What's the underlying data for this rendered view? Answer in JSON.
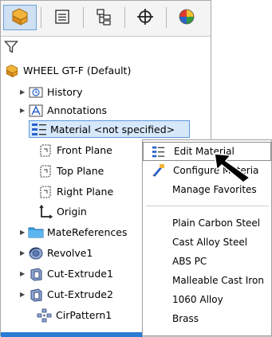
{
  "toolbar": {
    "icons": [
      "featuremanager-icon",
      "propertymanager-icon",
      "configurationmanager-icon",
      "dimxpert-icon",
      "display-manager-icon"
    ],
    "active_index": 0
  },
  "filter": {
    "icon": "filter-icon"
  },
  "tree": {
    "root": {
      "label": "WHEEL GT-F  (Default)",
      "icon": "part-icon"
    },
    "items": [
      {
        "label": "History",
        "icon": "history-icon",
        "expandable": true
      },
      {
        "label": "Annotations",
        "icon": "annotations-icon",
        "expandable": true
      },
      {
        "label": "Material <not specified>",
        "icon": "material-icon",
        "expandable": false,
        "selected": true
      },
      {
        "label": "Front Plane",
        "icon": "plane-icon",
        "expandable": false
      },
      {
        "label": "Top Plane",
        "icon": "plane-icon",
        "expandable": false
      },
      {
        "label": "Right Plane",
        "icon": "plane-icon",
        "expandable": false
      },
      {
        "label": "Origin",
        "icon": "origin-icon",
        "expandable": false
      },
      {
        "label": "MateReferences",
        "icon": "folder-icon",
        "expandable": true
      },
      {
        "label": "Revolve1",
        "icon": "revolve-icon",
        "expandable": true
      },
      {
        "label": "Cut-Extrude1",
        "icon": "cut-extrude-icon",
        "expandable": true
      },
      {
        "label": "Cut-Extrude2",
        "icon": "cut-extrude-icon",
        "expandable": true
      },
      {
        "label": "CirPattern1",
        "icon": "circular-pattern-icon",
        "expandable": false
      }
    ]
  },
  "context_menu": {
    "items": [
      {
        "label": "Edit Material",
        "icon": "edit-material-icon",
        "highlighted": true
      },
      {
        "label": "Configure Materia",
        "icon": "configure-material-icon"
      },
      {
        "label": "Manage Favorites"
      }
    ],
    "materials": [
      "Plain Carbon Steel",
      "Cast Alloy Steel",
      "ABS PC",
      "Malleable Cast Iron",
      "1060 Alloy",
      "Brass"
    ]
  },
  "colors": {
    "selection_bg": "#d7e8fb",
    "selection_border": "#5b98dc",
    "accent": "#2a7bd4"
  }
}
